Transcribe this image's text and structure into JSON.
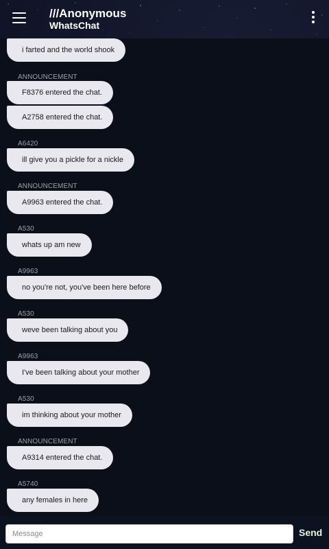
{
  "header": {
    "title": "///Anonymous",
    "subtitle": "WhatsChat",
    "menu_icon": "hamburger-menu-icon",
    "more_icon": "more-vert-icon"
  },
  "messages": [
    {
      "sender": "",
      "text": "i farted and the world shook"
    },
    {
      "sender": "ANNOUNCEMENT",
      "text": "F8376 entered the chat."
    },
    {
      "sender": "",
      "text": "A2758 entered the chat."
    },
    {
      "sender": "A6420",
      "text": "ill give you a pickle for a nickle"
    },
    {
      "sender": "ANNOUNCEMENT",
      "text": "A9963 entered the chat."
    },
    {
      "sender": "A530",
      "text": "whats up am new"
    },
    {
      "sender": "A9963",
      "text": "no you're not, you've been here before"
    },
    {
      "sender": "A530",
      "text": "weve been talking about you"
    },
    {
      "sender": "A9963",
      "text": "I've been talking about your mother"
    },
    {
      "sender": "A530",
      "text": "im thinking about your mother"
    },
    {
      "sender": "ANNOUNCEMENT",
      "text": "A9314 entered the chat."
    },
    {
      "sender": "A5740",
      "text": "any females in here"
    }
  ],
  "composer": {
    "placeholder": "Message",
    "value": "",
    "send_label": "Send"
  },
  "colors": {
    "background": "#0b0f1a",
    "bubble": "#e9e8ef",
    "sender_label": "#9aa0ac",
    "send_text": "#dff7df"
  }
}
